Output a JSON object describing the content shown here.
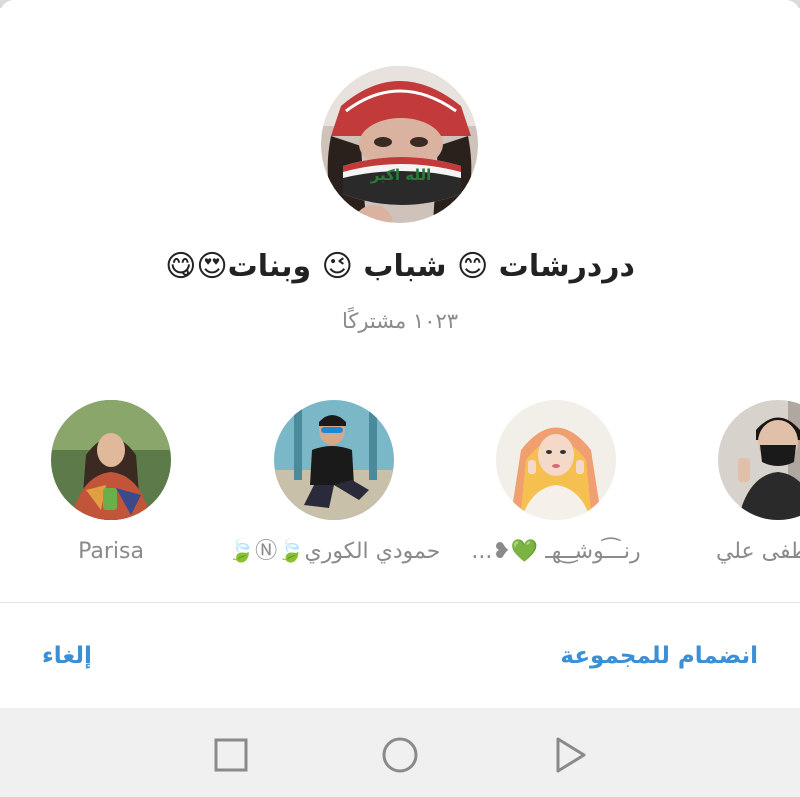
{
  "group": {
    "title": "دردرشات 😊 شباب 😉 وبنات😍😋",
    "subscribers": "١٠٢٣ مشتركًا"
  },
  "members": [
    {
      "name": "Parisa"
    },
    {
      "name": "حمودي الكوري🍃Ⓝ🍃"
    },
    {
      "name": "رنــ͡ـوشـ͜ـهـ 💚❥..."
    },
    {
      "name": "مصطفى علي"
    }
  ],
  "actions": {
    "join_label": "انضمام للمجموعة",
    "cancel_label": "إلغاء"
  },
  "colors": {
    "accent": "#3a8fd6",
    "title": "#222222",
    "muted": "#8a8a8a",
    "navbar": "#f0f0f0"
  },
  "icons": {
    "nav_recents": "square-icon",
    "nav_home": "circle-icon",
    "nav_back": "triangle-icon"
  }
}
